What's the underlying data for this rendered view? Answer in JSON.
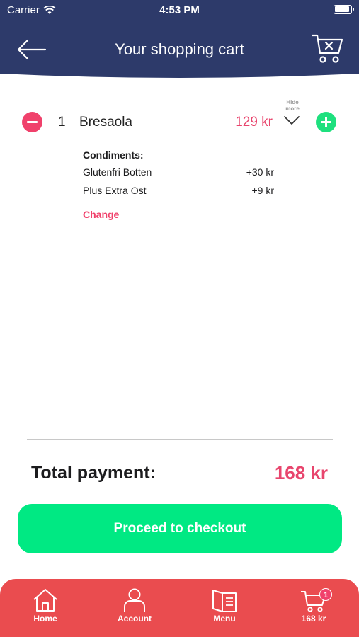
{
  "status_bar": {
    "carrier": "Carrier",
    "time": "4:53 PM"
  },
  "header": {
    "title": "Your shopping cart",
    "bg_color": "#2d3a6a"
  },
  "cart_item": {
    "quantity": "1",
    "name": "Bresaola",
    "price": "129 kr",
    "toggle_label": "Hide more",
    "condiments_title": "Condiments:",
    "condiments": [
      {
        "name": "Glutenfri Botten",
        "price": "+30 kr"
      },
      {
        "name": "Plus Extra Ost",
        "price": "+9 kr"
      }
    ],
    "change_label": "Change"
  },
  "total": {
    "label": "Total payment:",
    "value": "168 kr"
  },
  "checkout": {
    "label": "Proceed to checkout",
    "color": "#00e983"
  },
  "tabbar": {
    "bg_color": "#ea4c4f",
    "tabs": [
      {
        "label": "Home",
        "icon": "home-icon"
      },
      {
        "label": "Account",
        "icon": "account-icon"
      },
      {
        "label": "Menu",
        "icon": "menu-book-icon"
      },
      {
        "label": "168 kr",
        "icon": "cart-icon",
        "badge": "1"
      }
    ]
  },
  "colors": {
    "accent_pink": "#e8456d",
    "accent_green": "#1ee07e"
  }
}
